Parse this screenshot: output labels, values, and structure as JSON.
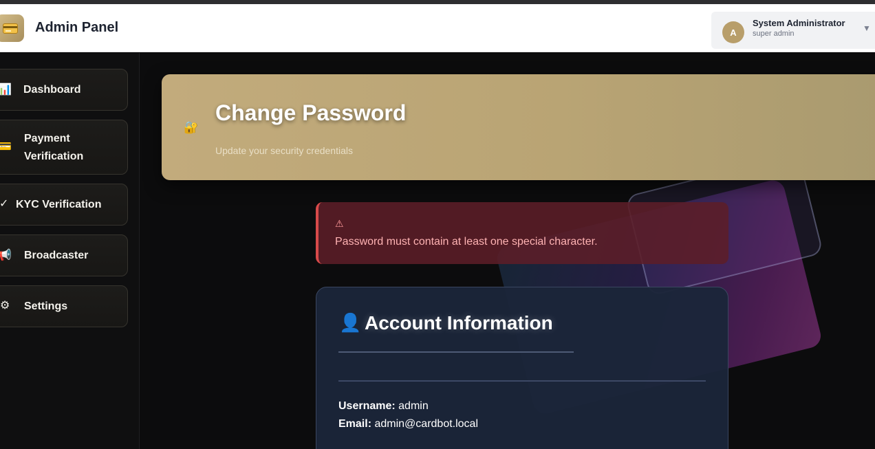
{
  "app": {
    "title": "Admin Panel",
    "logo_icon": "credit-card-icon"
  },
  "user": {
    "avatar_letter": "A",
    "name": "System Administrator",
    "role": "super admin",
    "menu_icon": "chevron-down-icon"
  },
  "sidebar": {
    "items": [
      {
        "label": "Dashboard",
        "icon": "bar-chart-icon"
      },
      {
        "label": "Payment Verification",
        "icon": "credit-card-icon"
      },
      {
        "label": "KYC Verification",
        "icon": "checkmark-icon"
      },
      {
        "label": "Broadcaster",
        "icon": "megaphone-icon"
      },
      {
        "label": "Settings",
        "icon": "gear-icon"
      }
    ]
  },
  "page": {
    "title": "Change Password",
    "subtitle": "Update your security credentials",
    "title_icon": "lock-key-icon"
  },
  "alert": {
    "icon": "warning-icon",
    "message": "Password must contain at least one special character."
  },
  "account": {
    "icon": "user-silhouette-icon",
    "title": "Account Information",
    "username_label": "Username:",
    "username_value": "admin",
    "email_label": "Email:",
    "email_value": "admin@cardbot.local"
  },
  "colors": {
    "accent": "#c2ab7c",
    "sidebar_bg": "#0f0f10",
    "error": "#d84a4a",
    "card_bg": "#1b2539"
  }
}
